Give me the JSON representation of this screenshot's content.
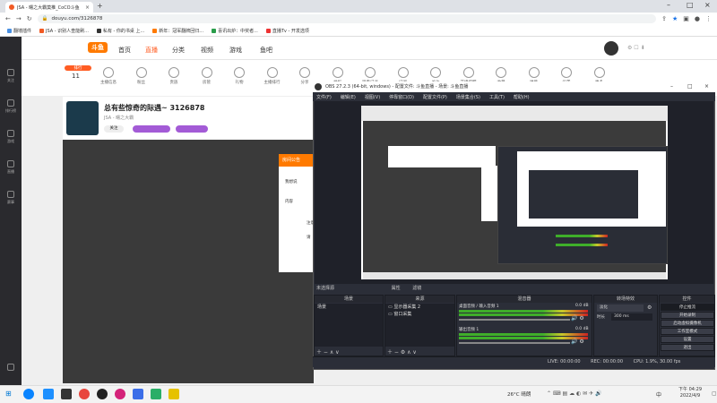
{
  "browser": {
    "tab_title": "JSA - 曙之大霸莫推_CoCO斗鱼",
    "url": "douyu.com/3126878",
    "bookmarks": [
      "翻墙插件",
      "JSA - 识别人查能刷...",
      "私有 - 你的书桌 上...",
      "新年：冠军翻牌回归...",
      "喜讯出炉：中奖者...",
      "直播Tv - 开发选项"
    ]
  },
  "site": {
    "logo": "斗鱼",
    "nav": [
      "首页",
      "直播",
      "分类",
      "视频",
      "游戏",
      "鱼吧"
    ],
    "left_nav": [
      "关注",
      "排行榜",
      "游戏",
      "直播",
      "赛事"
    ],
    "toolbar_count": "11",
    "toolbar_items": [
      "主播信息",
      "粉丝",
      "贵族",
      "房管",
      "礼物",
      "主播排行",
      "分享",
      "举报",
      "观看记录",
      "订阅",
      "关注",
      "开播提醒",
      "收藏",
      "弹幕",
      "设置",
      "更多"
    ],
    "stream_title": "总有些惊奇的际遇~ 3126878",
    "stream_meta": "JSA - 曙之大霸",
    "follow_count": "关注",
    "modal_header": "房间公告",
    "modal_lines": [
      "我想说",
      "内容",
      "注意",
      "请"
    ]
  },
  "obs": {
    "title": "OBS 27.2.3 (64-bit, windows) - 配置文件: 斗鱼直播 - 场景: 斗鱼直播",
    "menu": [
      "文件(F)",
      "编辑(E)",
      "视图(V)",
      "停靠窗口(D)",
      "配置文件(P)",
      "场景集合(S)",
      "工具(T)",
      "帮助(H)"
    ],
    "source_bar": [
      "未选择源",
      "属性",
      "滤镜"
    ],
    "dock_titles": [
      "场景",
      "来源",
      "混音器",
      "转场特效",
      "控件"
    ],
    "scene": "场景",
    "sources": [
      "显示器采集 2",
      "窗口采集"
    ],
    "mixer": [
      {
        "name": "桌面音频 / 输入音频 1",
        "db": "0.0 dB"
      },
      {
        "name": "输出音频 1",
        "db": "0.0 dB"
      }
    ],
    "transition": "淡化",
    "duration_label": "时长",
    "duration": "300 ms",
    "controls": [
      "停止推流",
      "开始录制",
      "启动虚拟摄像机",
      "工作室模式",
      "设置",
      "退出"
    ],
    "status": {
      "live": "LIVE: 00:00:00",
      "rec": "REC: 00:00:00",
      "cpu": "CPU: 1.9%, 30.00 fps"
    }
  },
  "taskbar": {
    "weather": "26°C 晴朗",
    "ime": "中",
    "time": "下午 04:29",
    "date": "2022/4/9"
  }
}
